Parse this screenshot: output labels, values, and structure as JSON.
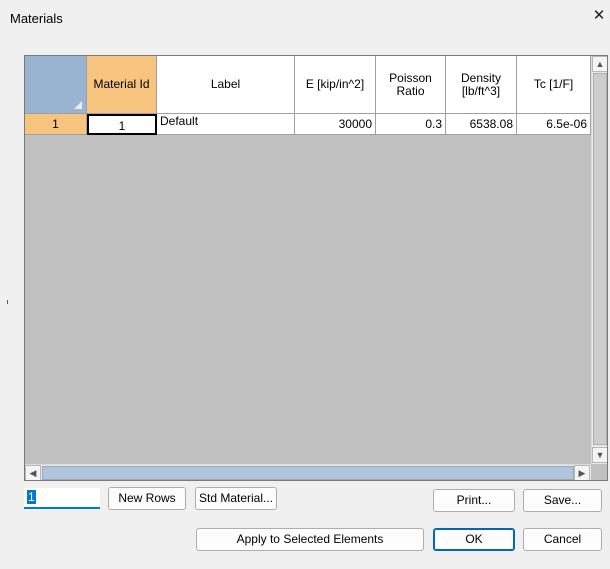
{
  "window": {
    "title": "Materials",
    "close_glyph": "✕"
  },
  "grid": {
    "columns": [
      "Material Id",
      "Label",
      "E [kip/in^2]",
      "Poisson\nRatio",
      "Density\n[lb/ft^3]",
      "Tc [1/F]"
    ],
    "rows": [
      {
        "row_number": "1",
        "material_id": "1",
        "label": "Default",
        "e": "30000",
        "poisson": "0.3",
        "density": "6538.08",
        "tc": "6.5e-06"
      }
    ]
  },
  "scroll": {
    "up": "▲",
    "down": "▼",
    "left": "◀",
    "right": "▶"
  },
  "controls": {
    "rows_value": "1",
    "new_rows": "New Rows",
    "std_material": "Std Material...",
    "print": "Print...",
    "save": "Save...",
    "apply": "Apply to Selected Elements",
    "ok": "OK",
    "cancel": "Cancel"
  },
  "colors": {
    "selected_header": "#f6c47f",
    "corner": "#99b4d1",
    "grid_empty": "#c0c0c0",
    "accent": "#0078d4"
  }
}
